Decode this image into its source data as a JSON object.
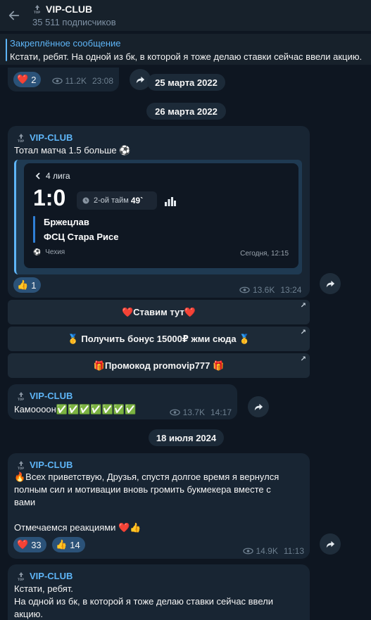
{
  "header": {
    "back_icon": "arrow-left-icon",
    "title": "VIP-CLUB",
    "subscribers": "35 511 подписчиков"
  },
  "pinned": {
    "title": "Закреплённое сообщение",
    "text": "Кстати, ребят. На одной из бк, в которой я тоже делаю ставки сейчас ввели акцию."
  },
  "top_partial": {
    "reaction_emoji": "❤️",
    "reaction_count": "2",
    "views": "11.2K",
    "time": "23:08"
  },
  "dates": {
    "d1": "25 марта 2022",
    "d2": "26 марта 2022",
    "d3": "18 июля 2024"
  },
  "msg1": {
    "sender": "VIP-CLUB",
    "text": "Тотал матча 1.5 больше ⚽",
    "reaction_emoji": "👍",
    "reaction_count": "1",
    "views": "13.6K",
    "time": "13:24",
    "card": {
      "league": "4 лига",
      "score": "1:0",
      "period": "2-ой тайм",
      "minute": "49`",
      "team1": "Бржецлав",
      "team2": "ФСЦ Стара Рисе",
      "country": "Чехия",
      "when": "Сегодня, 12:15"
    }
  },
  "buttons": [
    "❤️Ставим  тут❤️",
    "🥇 Получить бонус 15000₽ жми сюда 🥇",
    "🎁Промокод promovip777 🎁"
  ],
  "msg2": {
    "sender": "VIP-CLUB",
    "text": "Камоооон✅✅✅✅✅✅✅",
    "views": "13.7K",
    "time": "14:17"
  },
  "msg3": {
    "sender": "VIP-CLUB",
    "line1": "🔥Всех приветствую, Друзья, спустя долгое время я вернулся",
    "line2": "полным сил и мотивации вновь громить букмекера вместе с",
    "line3": "вами",
    "line4": "Отмечаемся реакциями ❤️👍",
    "reaction1_emoji": "❤️",
    "reaction1_count": "33",
    "reaction2_emoji": "👍",
    "reaction2_count": "14",
    "views": "14.9K",
    "time": "11:13"
  },
  "msg4": {
    "sender": "VIP-CLUB",
    "line1": "Кстати, ребят.",
    "line2": "На одной из бк, в которой я тоже делаю ставки сейчас ввели",
    "line3": "акцию."
  },
  "colors": {
    "background": "#0e1621",
    "bubble": "#182533",
    "accent": "#5eb5f7",
    "reaction": "#2b5278"
  }
}
